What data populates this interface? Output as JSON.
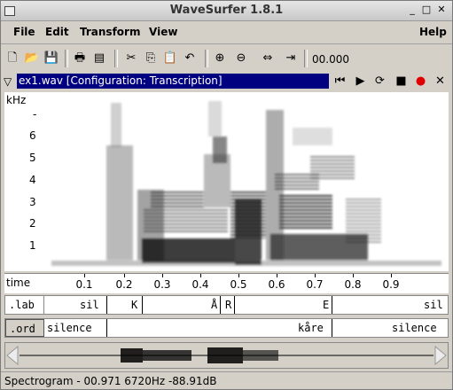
{
  "window": {
    "title": "WaveSurfer 1.8.1"
  },
  "menu": {
    "file": "File",
    "edit": "Edit",
    "transform": "Transform",
    "view": "View",
    "help": "Help"
  },
  "toolbar": {
    "icons": [
      "new-file-icon",
      "open-folder-icon",
      "save-icon",
      "print-icon",
      "properties-icon",
      "cut-icon",
      "copy-icon",
      "paste-icon",
      "undo-icon",
      "zoom-in-icon",
      "zoom-out-icon",
      "zoom-fit-icon",
      "zoom-selection-icon"
    ],
    "time": "00.000"
  },
  "file": {
    "label": "ex1.wav   [Configuration: Transcription]"
  },
  "spectrogram": {
    "unit": "kHz",
    "freq_labels": [
      "-",
      "6",
      "5",
      "4",
      "3",
      "2",
      "1"
    ]
  },
  "time_axis": {
    "label": "time",
    "ticks": [
      "0.1",
      "0.2",
      "0.3",
      "0.4",
      "0.5",
      "0.6",
      "0.7",
      "0.8",
      "0.9"
    ]
  },
  "tiers": [
    {
      "name": ".lab",
      "segments": [
        "sil",
        "K",
        "Å",
        "R",
        "E",
        "sil"
      ]
    },
    {
      "name": ".ord",
      "segments": [
        "silence",
        "kåre",
        "silence"
      ]
    }
  ],
  "status": {
    "text": "Spectrogram - 00.971 6720Hz -88.91dB"
  },
  "colors": {
    "file_bar": "#000080",
    "record": "#e00000",
    "background": "#d4d0c8"
  }
}
